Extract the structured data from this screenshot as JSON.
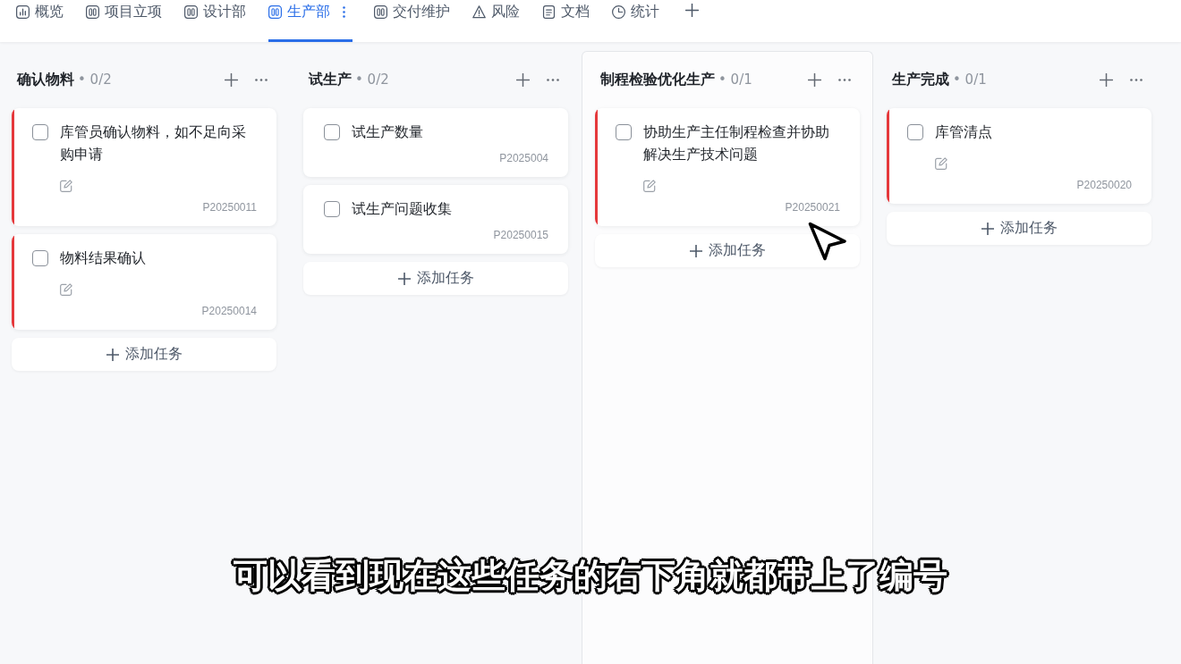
{
  "tabs": [
    {
      "label": "概览",
      "kind": "overview",
      "selected": false
    },
    {
      "label": "项目立项",
      "kind": "board",
      "selected": false
    },
    {
      "label": "设计部",
      "kind": "board",
      "selected": false
    },
    {
      "label": "生产部",
      "kind": "board",
      "selected": true
    },
    {
      "label": "交付维护",
      "kind": "board",
      "selected": false
    },
    {
      "label": "风险",
      "kind": "risk",
      "selected": false
    },
    {
      "label": "文档",
      "kind": "document",
      "selected": false
    },
    {
      "label": "统计",
      "kind": "stats",
      "selected": false
    }
  ],
  "columns": [
    {
      "title": "确认物料",
      "count": "• 0/2",
      "highlighted": false,
      "cards": [
        {
          "title": "库管员确认物料，如不足向采购申请",
          "checked": false,
          "edit_icon": true,
          "code": "P20250011",
          "color": "#e5383b"
        },
        {
          "title": "物料结果确认",
          "checked": false,
          "edit_icon": true,
          "code": "P20250014",
          "color": "#e5383b"
        }
      ],
      "add_label": "添加任务"
    },
    {
      "title": "试生产",
      "count": "• 0/2",
      "highlighted": false,
      "cards": [
        {
          "title": "试生产数量",
          "checked": false,
          "edit_icon": false,
          "code": "P2025004"
        },
        {
          "title": "试生产问题收集",
          "checked": false,
          "edit_icon": false,
          "code": "P20250015"
        }
      ],
      "add_label": "添加任务"
    },
    {
      "title": "制程检验优化生产",
      "count": "• 0/1",
      "highlighted": true,
      "cards": [
        {
          "title": "协助生产主任制程检查并协助解决生产技术问题",
          "checked": false,
          "edit_icon": true,
          "code": "P20250021",
          "color": "#e5383b"
        }
      ],
      "add_label": "添加任务"
    },
    {
      "title": "生产完成",
      "count": "• 0/1",
      "highlighted": false,
      "cards": [
        {
          "title": "库管清点",
          "checked": false,
          "edit_icon": true,
          "code": "P20250020",
          "color": "#e5383b"
        }
      ],
      "add_label": "添加任务"
    }
  ],
  "subtitle": "可以看到现在这些任务的右下角就都带上了编号"
}
